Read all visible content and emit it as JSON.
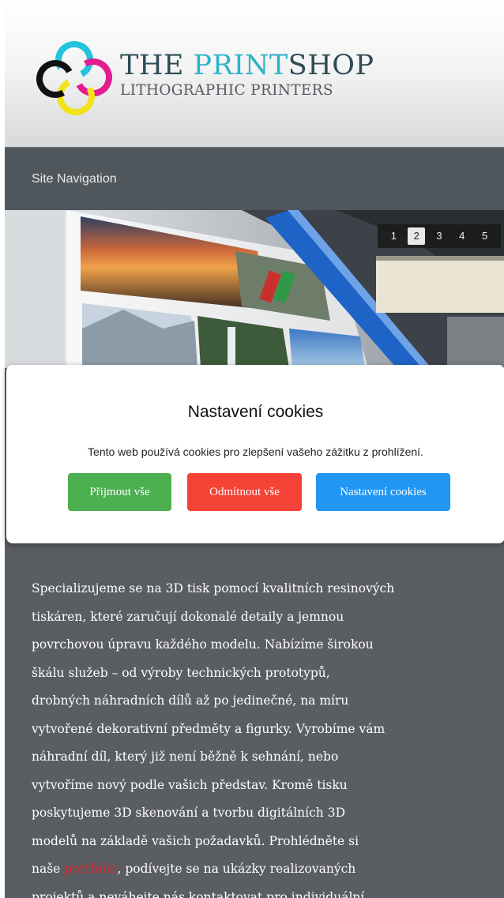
{
  "header": {
    "logo_title_part1": "THE ",
    "logo_title_accent": "PRINT",
    "logo_title_part2": "SHOP",
    "logo_subtitle": "LITHOGRAPHIC PRINTERS"
  },
  "nav": {
    "label": "Site Navigation"
  },
  "slider": {
    "pages": [
      "1",
      "2",
      "3",
      "4",
      "5"
    ],
    "active_page": "2"
  },
  "cookie_dialog": {
    "title": "Nastavení cookies",
    "text": "Tento web používá cookies pro zlepšení vašeho zážitku z prohlížení.",
    "accept_label": "Přijmout vše",
    "reject_label": "Odmítnout vše",
    "settings_label": "Nastavení cookies"
  },
  "content": {
    "lines": [
      "Specializujeme se na 3D tisk pomocí kvalitních resinových",
      "tiskáren, které zaručují dokonalé detaily a jemnou",
      "povrchovou úpravu každého modelu. Nabízíme širokou",
      "škálu služeb – od výroby technických prototypů,",
      "drobných náhradních dílů až po jedinečné, na míru",
      "vytvořené dekorativní předměty a figurky. Vyrobíme vám",
      "náhradní díl, který již není běžně k sehnání, nebo",
      "vytvoříme nový podle vašich představ. Kromě tisku",
      "poskytujeme 3D skenování a tvorbu digitálních 3D",
      "modelů na základě vašich požadavků. Prohlédněte si"
    ],
    "portfolio_prefix": "naše ",
    "portfolio_link": "portfolio",
    "portfolio_suffix": ", podívejte se na ukázky realizovaných",
    "last_line": "projektů a neváhejte nás kontaktovat pro individuální"
  },
  "colors": {
    "accent_cyan": "#2bb3c7",
    "accept_green": "#4caf50",
    "reject_red": "#f44336",
    "settings_blue": "#2196f3",
    "link_red": "#e4232c"
  }
}
